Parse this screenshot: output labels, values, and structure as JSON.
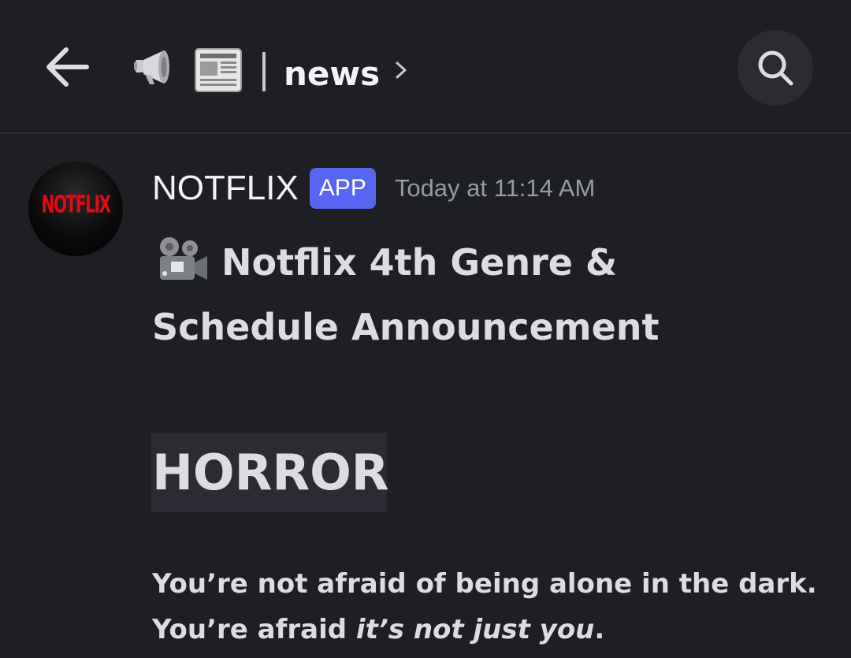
{
  "header": {
    "back_icon": "arrow-left-icon",
    "channel_icons": [
      "megaphone-icon",
      "newspaper-icon"
    ],
    "separator": "|",
    "channel_name": "news",
    "chevron": "chevron-right-icon",
    "search_icon": "search-icon"
  },
  "message": {
    "avatar_text": "NOTFLIX",
    "author": "NOTFLIX",
    "badge": "APP",
    "timestamp": "Today at 11:14 AM",
    "title_icon": "movie-camera-icon",
    "title_line1": "Notflix 4th Genre &",
    "title_line2": "Schedule Announcement",
    "genre": "HORROR",
    "tagline_line1": "You’re not afraid of being alone in the dark.",
    "tagline_line2_start": "You’re afraid ",
    "tagline_line2_emphasis": "it’s not just you",
    "tagline_line2_end": "."
  },
  "colors": {
    "background": "#1e1f24",
    "badge": "#5865f2",
    "timestamp": "#949ba4",
    "brand_red": "#e50914"
  }
}
